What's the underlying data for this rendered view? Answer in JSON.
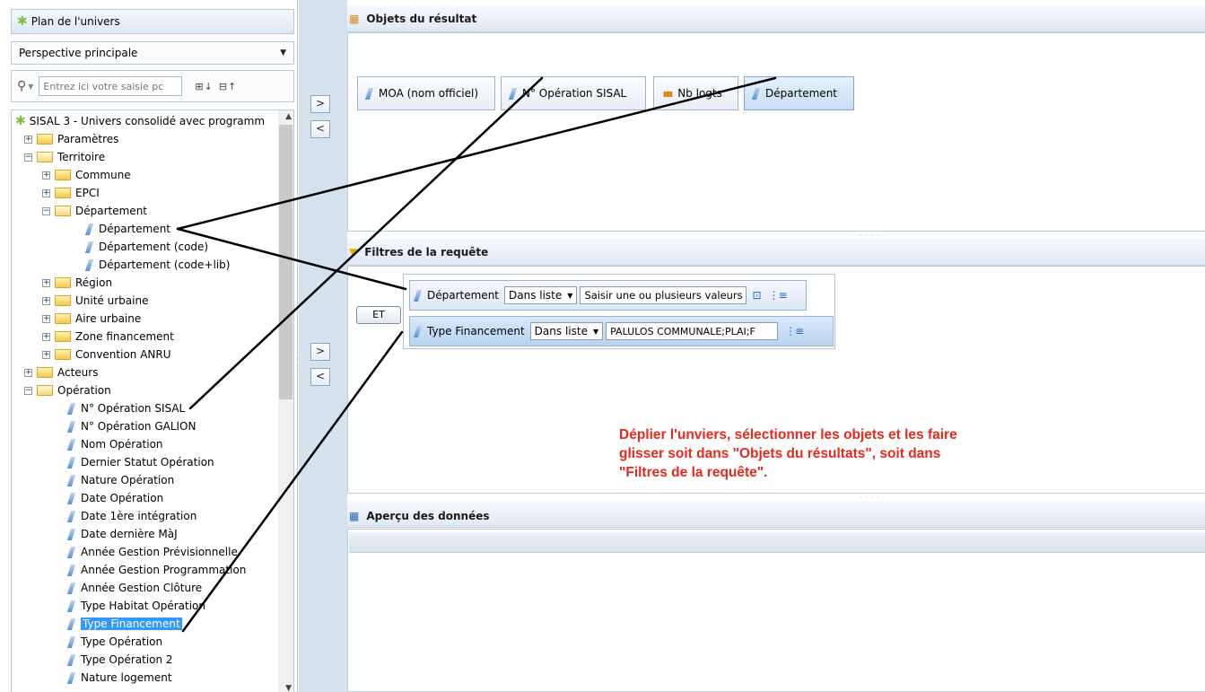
{
  "left_panel": {
    "title": "Plan de l'univers",
    "perspective": "Perspective principale",
    "search_placeholder": "Entrez ici votre saisie pc",
    "tree": {
      "root": "SISAL 3 - Univers consolidé avec programm",
      "parametres": "Paramètres",
      "territoire": "Territoire",
      "commune": "Commune",
      "epci": "EPCI",
      "departement_folder": "Département",
      "departement": "Département",
      "departement_code": "Département (code)",
      "departement_codelib": "Département (code+lib)",
      "region": "Région",
      "unite_urbaine": "Unité urbaine",
      "aire_urbaine": "Aire urbaine",
      "zone_financement": "Zone financement",
      "convention_anru": "Convention ANRU",
      "acteurs": "Acteurs",
      "operation": "Opération",
      "op_items": [
        "N° Opération SISAL",
        "N° Opération GALION",
        "Nom Opération",
        "Dernier Statut Opération",
        "Nature Opération",
        "Date Opération",
        "Date 1ère intégration",
        "Date dernière MàJ",
        "Année Gestion Prévisionnelle",
        "Année Gestion Programmation",
        "Année Gestion Clôture",
        "Type Habitat Opération",
        "Type Financement",
        "Type Opération",
        "Type Opération 2",
        "Nature logement"
      ]
    }
  },
  "buttons": {
    "add": ">",
    "remove": "<"
  },
  "result_objects": {
    "title": "Objets du résultat",
    "items": [
      "MOA (nom officiel)",
      "N° Opération SISAL",
      "Nb logts",
      "Département"
    ]
  },
  "filters": {
    "title": "Filtres de la requête",
    "operator": "ET",
    "rows": [
      {
        "object": "Département",
        "op": "Dans liste",
        "value": "Saisir une ou plusieurs valeurs"
      },
      {
        "object": "Type Financement",
        "op": "Dans liste",
        "value": "PALULOS COMMUNALE;PLAI;F"
      }
    ]
  },
  "annotation": {
    "line1": "Déplier l'unviers, sélectionner les objets et les faire",
    "line2": "glisser soit dans \"Objets du résultats\", soit dans",
    "line3": "\"Filtres de la requête\"."
  },
  "preview": {
    "title": "Aperçu des données"
  },
  "colors": {
    "annotation": "#e8291c",
    "selection": "#3399ff",
    "panel_border": "#b9c9dc"
  }
}
